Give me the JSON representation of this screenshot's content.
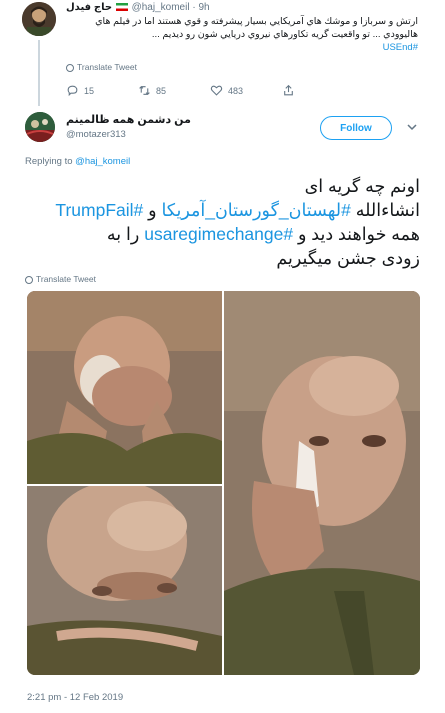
{
  "parent_tweet": {
    "display_name": "حاج فيدل",
    "handle": "@haj_komeil",
    "time": "· 9h",
    "text": "ارتش و سربازا و موشك هاي آمريكايي بسيار پيشرفته و قوي هستند اما در فيلم هاي هاليوودي ... تو واقعيت گريه تكاورهاي نيروي دريايي شون رو ديديم ...",
    "hashtag": "#USEnd",
    "translate_label": "Translate Tweet",
    "reply_count": "15",
    "retweet_count": "85",
    "like_count": "483"
  },
  "main_tweet": {
    "display_name": "من دشمن همه ظالمینم",
    "handle": "@motazer313",
    "follow_label": "Follow",
    "replying_prefix": "Replying to",
    "replying_to": "@haj_komeil",
    "text_line1": "اونم چه گریه ای",
    "text_line2_a": "انشاءالله",
    "text_line2_tag1": "#لهستان_گورستان_آمریکا",
    "text_line2_b": "و",
    "text_line2_tag2": "#TrumpFail",
    "text_line3_a": "همه خواهند دید و",
    "text_line3_tag": "#usaregimechange",
    "text_line3_b": "را به",
    "text_line4": "زودی جشن میگیریم",
    "translate_label": "Translate Tweet",
    "timestamp": "2:21 pm - 12 Feb 2019"
  },
  "colors": {
    "link": "#1b95e0",
    "follow_border": "#1da1f2",
    "muted": "#657786",
    "thread_line": "#ccd6dd"
  },
  "icons": [
    "reply-icon",
    "retweet-icon",
    "like-icon",
    "share-icon",
    "globe-icon",
    "chevron-down-icon"
  ]
}
